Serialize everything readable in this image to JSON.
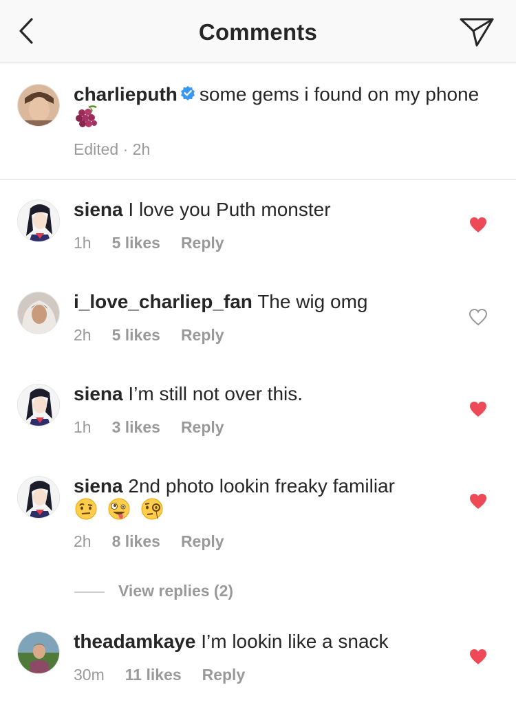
{
  "header": {
    "title": "Comments"
  },
  "caption": {
    "username": "charlieputh",
    "text": "some gems i found on my phone",
    "emoji": "🍇",
    "meta": "Edited · 2h"
  },
  "comments": [
    {
      "username": "siena",
      "text": "I love you Puth monster",
      "time": "1h",
      "likes": "5 likes",
      "reply": "Reply",
      "liked": true
    },
    {
      "username": "i_love_charliep_fan",
      "text": "The wig omg",
      "time": "2h",
      "likes": "5 likes",
      "reply": "Reply",
      "liked": false
    },
    {
      "username": "siena",
      "text": "I’m still not over this.",
      "time": "1h",
      "likes": "3 likes",
      "reply": "Reply",
      "liked": true
    },
    {
      "username": "siena",
      "text": "2nd photo lookin freaky familiar",
      "emojis": [
        "🤨",
        "🤪",
        "🧐"
      ],
      "time": "2h",
      "likes": "8 likes",
      "reply": "Reply",
      "liked": true
    },
    {
      "username": "theadamkaye",
      "text": "I’m lookin like a snack",
      "time": "30m",
      "likes": "11 likes",
      "reply": "Reply",
      "liked": true
    }
  ],
  "view_replies": "View replies (2)",
  "icons": {
    "back": "chevron-left-icon",
    "send": "paper-plane-icon",
    "verified": "verified-badge-icon",
    "heart_filled": "heart-filled-icon",
    "heart_outline": "heart-outline-icon"
  },
  "colors": {
    "header_bg": "#f9f9f9",
    "text": "#262626",
    "muted": "#999999",
    "heart": "#ed4956",
    "verified": "#3897f0",
    "divider": "#dbdbdb"
  }
}
